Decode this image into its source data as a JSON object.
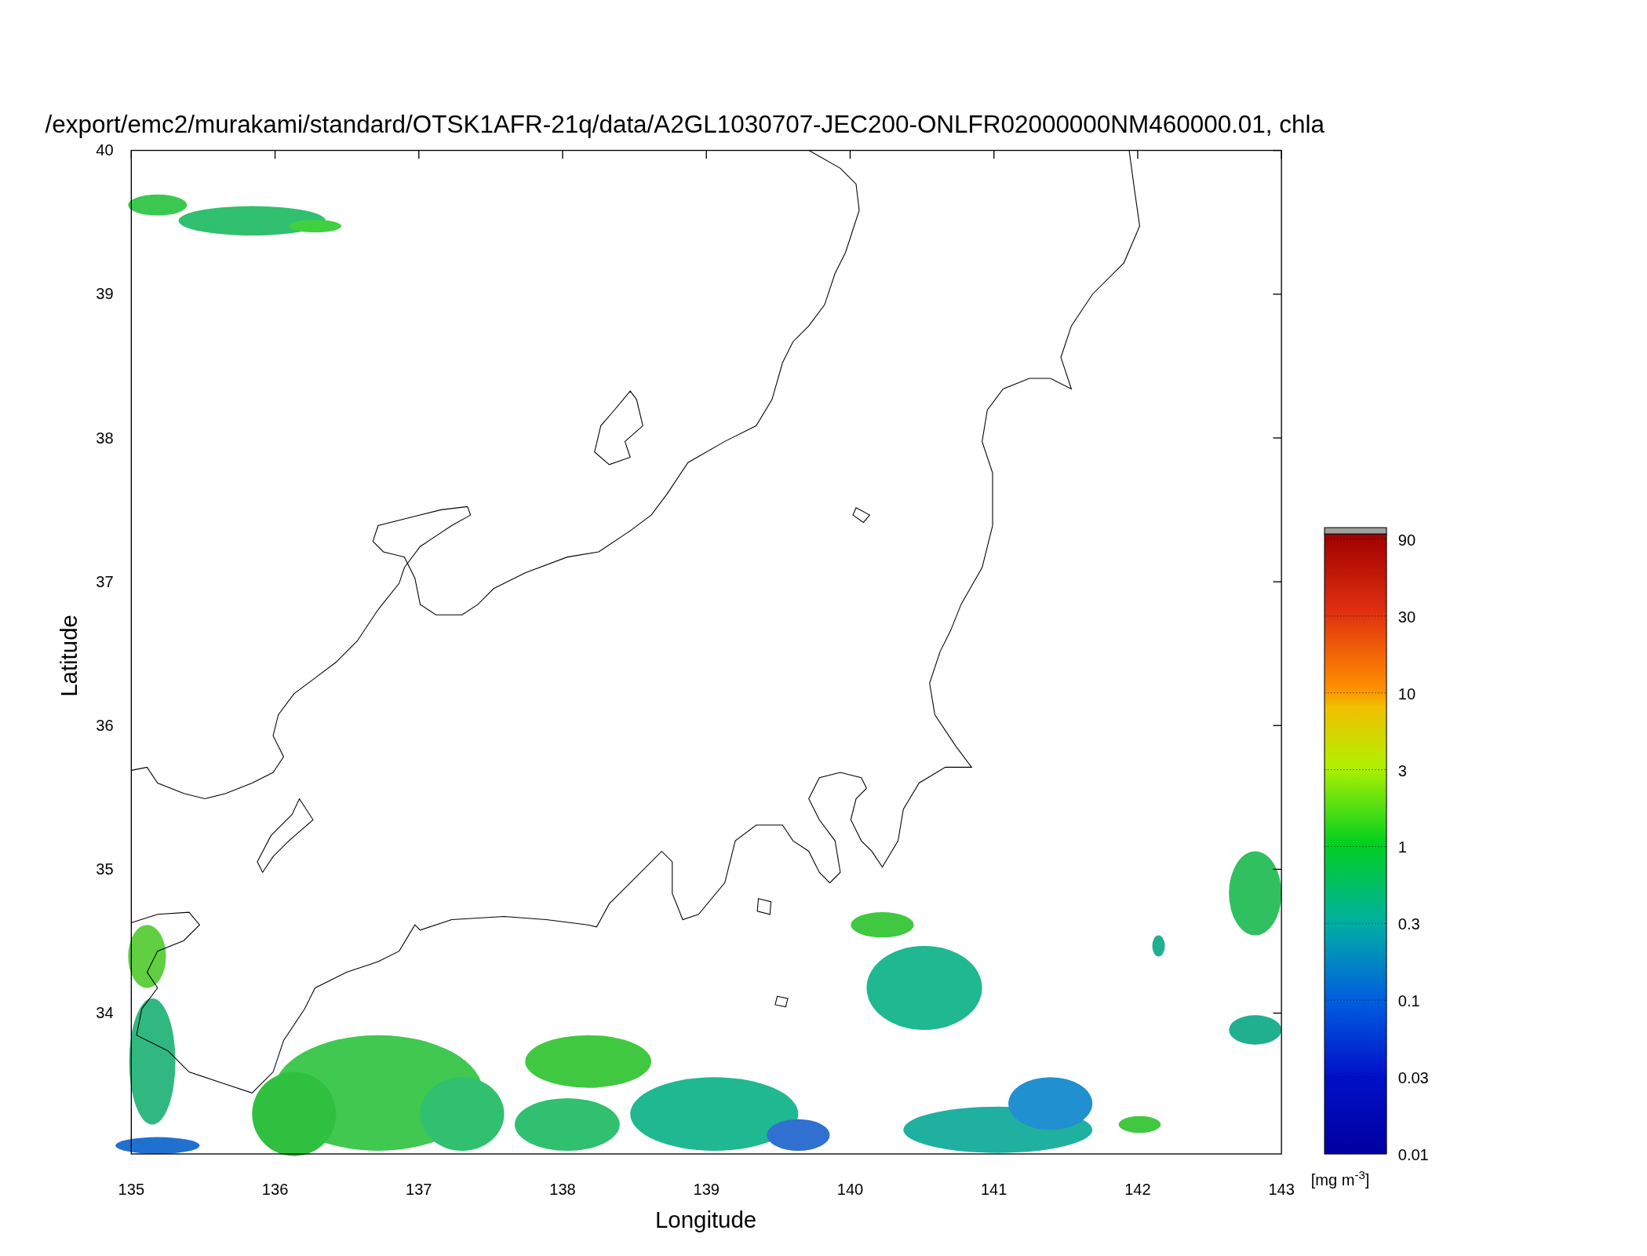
{
  "title": "/export/emc2/murakami/standard/OTSK1AFR-21q/data/A2GL1030707-JEC200-ONLFR02000000NM460000.01, chla",
  "xlabel": "Longitude",
  "ylabel": "Latitude",
  "xticks": [
    "135",
    "136",
    "137",
    "138",
    "139",
    "140",
    "141",
    "142",
    "143"
  ],
  "yticks": [
    "40",
    "39",
    "38",
    "37",
    "36",
    "35",
    "34"
  ],
  "colorbar": {
    "ticks": [
      "90",
      "30",
      "10",
      "3",
      "1",
      "0.3",
      "0.1",
      "0.03",
      "0.01"
    ],
    "unit": "[mg m$^{-3}$]"
  }
}
